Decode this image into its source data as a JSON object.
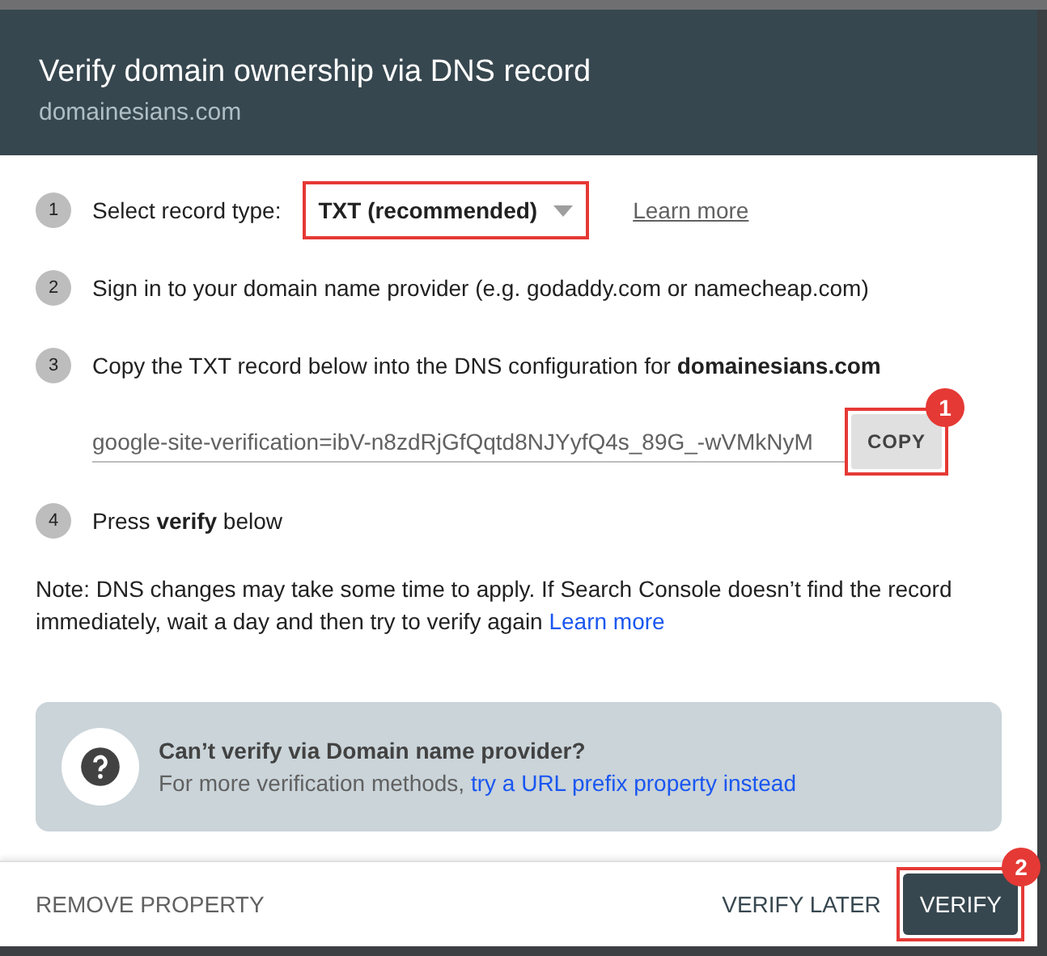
{
  "header": {
    "title": "Verify domain ownership via DNS record",
    "subtitle": "domainesians.com"
  },
  "steps": [
    {
      "number": "1",
      "kind": "select",
      "text": "Select record type:",
      "select": {
        "value": "TXT (recommended)",
        "highlighted": true
      },
      "link": "Learn more"
    },
    {
      "number": "2",
      "kind": "text",
      "text": "Sign in to your domain name provider (e.g. godaddy.com or namecheap.com)"
    },
    {
      "number": "3",
      "kind": "record",
      "text": "Copy the TXT record below into the DNS configuration for **domainesians.com**",
      "record": "google-site-verification=ibV-n8zdRjGfQqtd8NJYyfQ4s_89G_-wVMkNyM",
      "copy_button": {
        "label": "COPY",
        "highlighted": true,
        "badge": "1"
      }
    },
    {
      "number": "4",
      "kind": "text",
      "text": "Press **verify** below"
    }
  ],
  "note": {
    "text": "Note: DNS changes may take some time to apply. If Search Console doesn’t find the record immediately, wait a day and then try to verify again",
    "link": "Learn more"
  },
  "info": {
    "title": "Can’t verify via Domain name provider?",
    "text": "For more verification methods,",
    "link": "try a URL prefix property instead"
  },
  "footer": {
    "remove": "REMOVE PROPERTY",
    "later": "VERIFY LATER",
    "verify": {
      "label": "VERIFY",
      "highlighted": true,
      "badge": "2"
    }
  }
}
